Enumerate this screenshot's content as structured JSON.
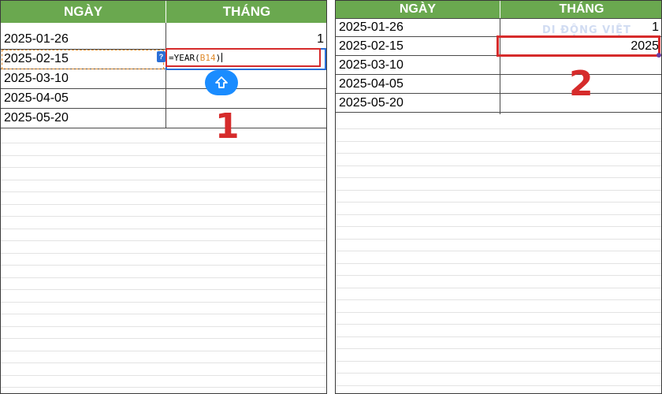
{
  "colors": {
    "header_bg": "#6aa84f",
    "highlight": "#d62b2b",
    "selection": "#2b6fd6",
    "button": "#1a8cff"
  },
  "left": {
    "headers": [
      "NGÀY",
      "THÁNG"
    ],
    "rows": [
      [
        "2025-01-26",
        "1"
      ],
      [
        "2025-02-15",
        ""
      ],
      [
        "2025-03-10",
        ""
      ],
      [
        "2025-04-05",
        ""
      ],
      [
        "2025-05-20",
        ""
      ]
    ],
    "formula_prefix": "=YEAR(",
    "formula_ref": "B14",
    "formula_suffix": ")",
    "badge_text": "?",
    "shift_icon": "shift-up-arrow-icon",
    "step_label": "1"
  },
  "right": {
    "headers": [
      "NGÀY",
      "THÁNG"
    ],
    "rows": [
      [
        "2025-01-26",
        "1"
      ],
      [
        "2025-02-15",
        "2025"
      ],
      [
        "2025-03-10",
        ""
      ],
      [
        "2025-04-05",
        ""
      ],
      [
        "2025-05-20",
        ""
      ]
    ],
    "watermark": "DI ĐỘNG VIỆT",
    "step_label": "2"
  }
}
